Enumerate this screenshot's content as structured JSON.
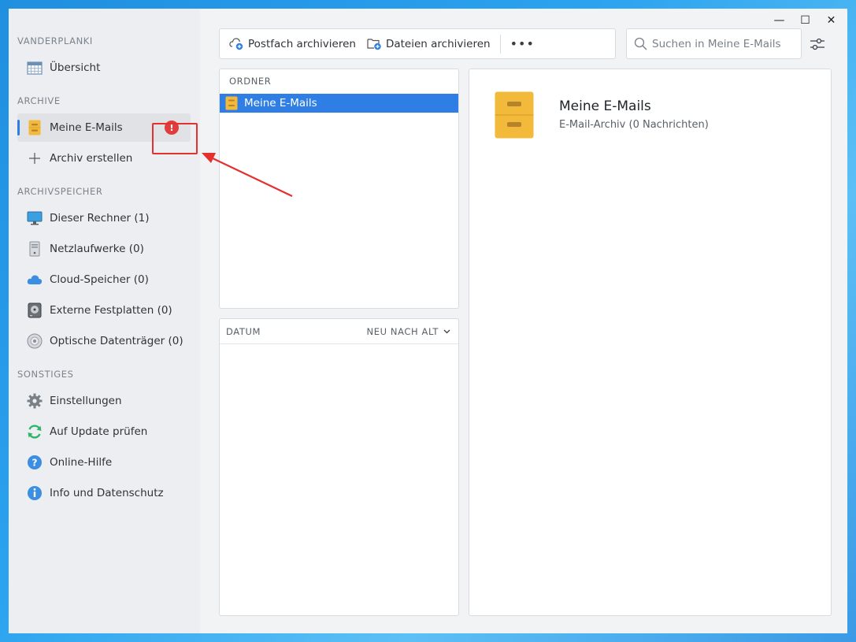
{
  "window": {
    "controls": {
      "minimize": "—",
      "maximize": "☐",
      "close": "✕"
    }
  },
  "sidebar": {
    "sections": [
      {
        "title": "VANDERPLANKI",
        "items": [
          {
            "label": "Übersicht",
            "icon": "calendar-grid-icon"
          }
        ]
      },
      {
        "title": "ARCHIVE",
        "items": [
          {
            "label": "Meine E-Mails",
            "icon": "filing-cabinet-icon",
            "active": true,
            "alert": "!"
          },
          {
            "label": "Archiv erstellen",
            "icon": "plus-icon"
          }
        ]
      },
      {
        "title": "ARCHIVSPEICHER",
        "items": [
          {
            "label": "Dieser Rechner (1)",
            "icon": "monitor-icon"
          },
          {
            "label": "Netzlaufwerke (0)",
            "icon": "server-icon"
          },
          {
            "label": "Cloud-Speicher (0)",
            "icon": "cloud-icon"
          },
          {
            "label": "Externe Festplatten (0)",
            "icon": "hard-drive-icon"
          },
          {
            "label": "Optische Datenträger (0)",
            "icon": "disc-icon"
          }
        ]
      },
      {
        "title": "SONSTIGES",
        "items": [
          {
            "label": "Einstellungen",
            "icon": "gear-icon"
          },
          {
            "label": "Auf Update prüfen",
            "icon": "refresh-icon"
          },
          {
            "label": "Online-Hilfe",
            "icon": "help-icon"
          },
          {
            "label": "Info und Datenschutz",
            "icon": "info-icon"
          }
        ]
      }
    ]
  },
  "toolbar": {
    "archive_mailbox_label": "Postfach archivieren",
    "archive_files_label": "Dateien archivieren",
    "more_label": "•••"
  },
  "search": {
    "placeholder": "Suchen in Meine E-Mails",
    "value": ""
  },
  "folders_panel": {
    "header": "ORDNER",
    "items": [
      {
        "label": "Meine E-Mails",
        "selected": true
      }
    ]
  },
  "dates_panel": {
    "header": "DATUM",
    "sort_label": "NEU NACH ALT"
  },
  "detail": {
    "title": "Meine E-Mails",
    "subtitle": "E-Mail-Archiv (0 Nachrichten)"
  },
  "colors": {
    "accent": "#2f7ee6",
    "alert": "#e23d3d",
    "cabinet": "#f2b93b"
  }
}
